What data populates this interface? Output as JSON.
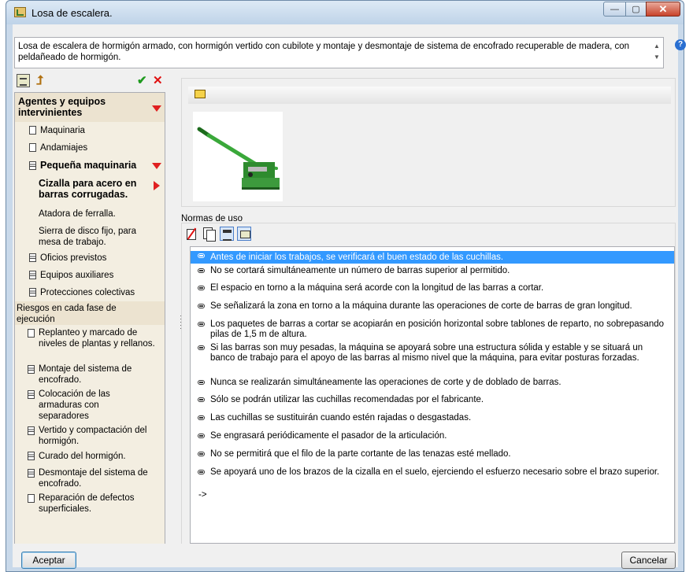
{
  "window": {
    "title": "Losa de escalera.",
    "min_glyph": "—",
    "max_glyph": "▢",
    "close_glyph": "✕"
  },
  "description": "Losa de escalera de hormigón armado, con hormigón vertido con cubilote y montaje y desmontaje de sistema de encofrado recuperable de madera, con peldañeado de hormigón.",
  "help_glyph": "?",
  "left_toolbar": {
    "check_glyph": "✔",
    "x_glyph": "✕",
    "up_glyph": "⮥"
  },
  "tree": {
    "items": [
      {
        "label": "Agentes y equipos intervinientes",
        "type": "header",
        "expanded": true
      },
      {
        "label": "Maquinaria",
        "type": "leaf"
      },
      {
        "label": "Andamiajes",
        "type": "leaf"
      },
      {
        "label": "Pequeña maquinaria",
        "type": "group",
        "expanded": true
      },
      {
        "label": "Cizalla para acero en barras corrugadas.",
        "type": "selected"
      },
      {
        "label": "Atadora de ferralla.",
        "type": "plain"
      },
      {
        "label": "Sierra de disco fijo, para mesa de trabajo.",
        "type": "plain"
      },
      {
        "label": "Oficios previstos",
        "type": "doc"
      },
      {
        "label": "Equipos auxiliares",
        "type": "doc"
      },
      {
        "label": "Protecciones colectivas",
        "type": "doc"
      },
      {
        "label": "Riesgos en cada fase de ejecución",
        "type": "section"
      },
      {
        "label": "Replanteo y marcado de niveles de plantas y rellanos.",
        "type": "leaf"
      },
      {
        "label": "Montaje del sistema de encofrado.",
        "type": "doc"
      },
      {
        "label": "Colocación de las armaduras con separadores",
        "type": "doc"
      },
      {
        "label": "Vertido y compactación del hormigón.",
        "type": "doc"
      },
      {
        "label": "Curado del hormigón.",
        "type": "doc"
      },
      {
        "label": "Desmontaje del sistema de encofrado.",
        "type": "doc"
      },
      {
        "label": "Reparación de defectos superficiales.",
        "type": "leaf"
      }
    ]
  },
  "normas": {
    "label": "Normas de uso",
    "items": [
      "Antes de iniciar los trabajos, se verificará el buen estado de las cuchillas.",
      "No se cortará simultáneamente un número de barras superior al permitido.",
      "El espacio en torno a la máquina será acorde con la longitud de las barras a cortar.",
      "Se señalizará la zona en torno a la máquina durante las operaciones de corte de barras de gran longitud.",
      "Los paquetes de barras a cortar se acopiarán en posición horizontal sobre tablones de reparto, no sobrepasando pilas de 1,5 m de altura.",
      "Si las barras son muy pesadas, la máquina se apoyará sobre una estructura sólida y estable y se situará un banco de trabajo para el apoyo de las barras al mismo nivel que la máquina, para evitar posturas forzadas.",
      "Nunca se realizarán simultáneamente las operaciones de corte y de doblado de barras.",
      "Sólo se podrán utilizar las cuchillas recomendadas por el fabricante.",
      "Las cuchillas se sustituirán cuando estén rajadas o desgastadas.",
      "Se engrasará periódicamente el pasador de la articulación.",
      "No se permitirá que el filo de la parte cortante de las tenazas esté mellado.",
      "Se apoyará uno de los brazos de la cizalla en el suelo, ejerciendo el esfuerzo necesario sobre el brazo superior."
    ],
    "end_marker": "->"
  },
  "buttons": {
    "accept": "Aceptar",
    "cancel": "Cancelar"
  }
}
